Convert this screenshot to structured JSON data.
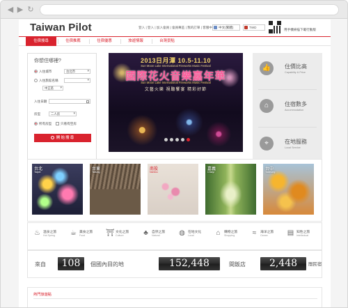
{
  "browser": {
    "back_icon": "back-arrow-icon",
    "forward_icon": "forward-arrow-icon",
    "reload_icon": "reload-icon"
  },
  "header": {
    "logo": "Taiwan Pilot",
    "top_links": "登入 | 登入 | 加入會員 | 會員專區 | 我的訂單 | 客服中心",
    "lang": "中文(繁體)",
    "currency": "TWD",
    "qr_text": "用手機掃描下載行動版"
  },
  "menu": [
    "住宿搜尋",
    "住宿推薦",
    "住宿優惠",
    "旅遊情報",
    "台灣景點"
  ],
  "search": {
    "title": "你想住哪裡?",
    "opt_area": "入住城市",
    "opt_area_value": "台北市",
    "opt_name": "入住旅館名稱",
    "opt_name_value": "",
    "opt_name_district": "中正區",
    "checkin_label": "入住日期",
    "rooms_label": "房型",
    "rooms_value": "二人房",
    "opt_all": "所有房型",
    "opt_avail": "只看有空房",
    "button": "開始搜尋"
  },
  "banner": {
    "date": "2013日月潭    10.5-11.10",
    "sub": "Sun Moon Lake International Fireworks Music Festival",
    "title": "國際花火音樂嘉年華",
    "en": "Sun Moon Lake International Fireworks Music Festival",
    "slogan": "文藝火樂  視聽饗宴  精彩好節"
  },
  "carousel": {
    "count": 5,
    "active": 4
  },
  "features": [
    {
      "title": "住價比高",
      "en": "Capability & Price",
      "icon": "thumbs-up-icon"
    },
    {
      "title": "住宿數多",
      "en": "Accommodation",
      "icon": "home-icon"
    },
    {
      "title": "在地服務",
      "en": "Local Service",
      "icon": "location-pin-icon"
    }
  ],
  "photos": [
    {
      "zh": "台北",
      "en": "Taipei"
    },
    {
      "zh": "台東",
      "en": "Taitung"
    },
    {
      "zh": "南投",
      "en": "Nantou"
    },
    {
      "zh": "嘉義",
      "en": "Chiayi"
    },
    {
      "zh": "台中",
      "en": "Taichung"
    }
  ],
  "categories": [
    {
      "zh": "溫泉之旅",
      "en": "Hot Spring",
      "icon": "hot-spring-icon"
    },
    {
      "zh": "美食之旅",
      "en": "Food",
      "icon": "food-icon"
    },
    {
      "zh": "文化之旅",
      "en": "Culture",
      "icon": "temple-icon"
    },
    {
      "zh": "自然之旅",
      "en": "Natural",
      "icon": "tree-icon"
    },
    {
      "zh": "在地文化",
      "en": "Local",
      "icon": "lantern-icon"
    },
    {
      "zh": "購物之旅",
      "en": "Shopping",
      "icon": "shopping-bag-icon"
    },
    {
      "zh": "海洋之旅",
      "en": "Ocean",
      "icon": "wave-icon"
    },
    {
      "zh": "知性之旅",
      "en": "Intellectual",
      "icon": "book-icon"
    }
  ],
  "stats": {
    "prefix": "來自",
    "countries": "108",
    "countries_suffix": "個國內目的地",
    "hotels": "152,448",
    "hotels_suffix": "間飯店",
    "homestays": "2,448",
    "homestays_suffix": "間民宿"
  },
  "hot": {
    "title": "熱門旅遊點"
  },
  "colors": {
    "brand": "#d9232e",
    "feature_bg": "#ececec"
  }
}
